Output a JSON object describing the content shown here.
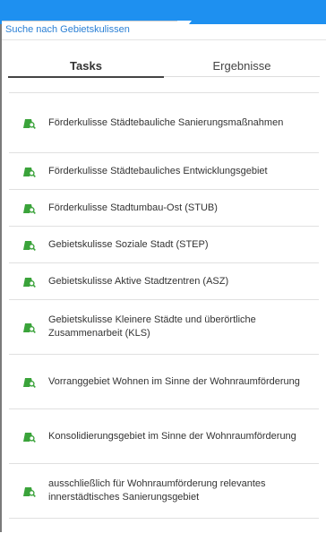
{
  "panel": {
    "tab_title": "Suche nach Gebietskulissen",
    "segments": [
      {
        "label": "Tasks",
        "selected": true
      },
      {
        "label": "Ergebnisse",
        "selected": false
      }
    ]
  },
  "tasks": [
    {
      "label": "Förderkulisse Städtebauliche Sanierungsmaßnahmen"
    },
    {
      "label": "Förderkulisse Städtebauliches Entwicklungsgebiet"
    },
    {
      "label": "Förderkulisse Stadtumbau-Ost (STUB)"
    },
    {
      "label": "Gebietskulisse Soziale Stadt (STEP)"
    },
    {
      "label": "Gebietskulisse Aktive Stadtzentren (ASZ)"
    },
    {
      "label": "Gebietskulisse Kleinere Städte und überörtliche Zusammenarbeit (KLS)"
    },
    {
      "label": "Vorranggebiet Wohnen im Sinne der Wohnraumförderung"
    },
    {
      "label": "Konsolidierungsgebiet im Sinne der Wohnraumförderung"
    },
    {
      "label": "ausschließlich für Wohnraumförderung relevantes innerstädtisches Sanierungsgebiet"
    }
  ],
  "colors": {
    "accent": "#1e90f0",
    "icon_green": "#3aa33a"
  },
  "icons": {
    "task": "map-search-icon"
  }
}
